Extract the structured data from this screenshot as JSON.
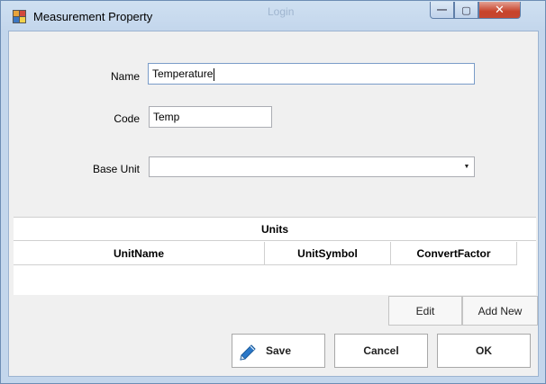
{
  "window": {
    "title": "Measurement Property",
    "faint_title": "Login",
    "minimize_glyph": "—",
    "maximize_glyph": "▢",
    "close_glyph": "✕"
  },
  "form": {
    "name_label": "Name",
    "name_value": "Temperature",
    "code_label": "Code",
    "code_value": "Temp",
    "base_unit_label": "Base Unit",
    "base_unit_value": ""
  },
  "units_grid": {
    "title": "Units",
    "columns": [
      "UnitName",
      "UnitSymbol",
      "ConvertFactor"
    ]
  },
  "grid_buttons": {
    "edit": "Edit",
    "add_new": "Add New"
  },
  "footer_buttons": {
    "save": "Save",
    "cancel": "Cancel",
    "ok": "OK"
  },
  "icons": {
    "app": "app-icon",
    "save": "pencil-icon",
    "dropdown": "chevron-down-icon"
  },
  "colors": {
    "titlebar": "#c3d6ec",
    "close_button": "#c7432b",
    "focus_border": "#7a9cc8"
  }
}
